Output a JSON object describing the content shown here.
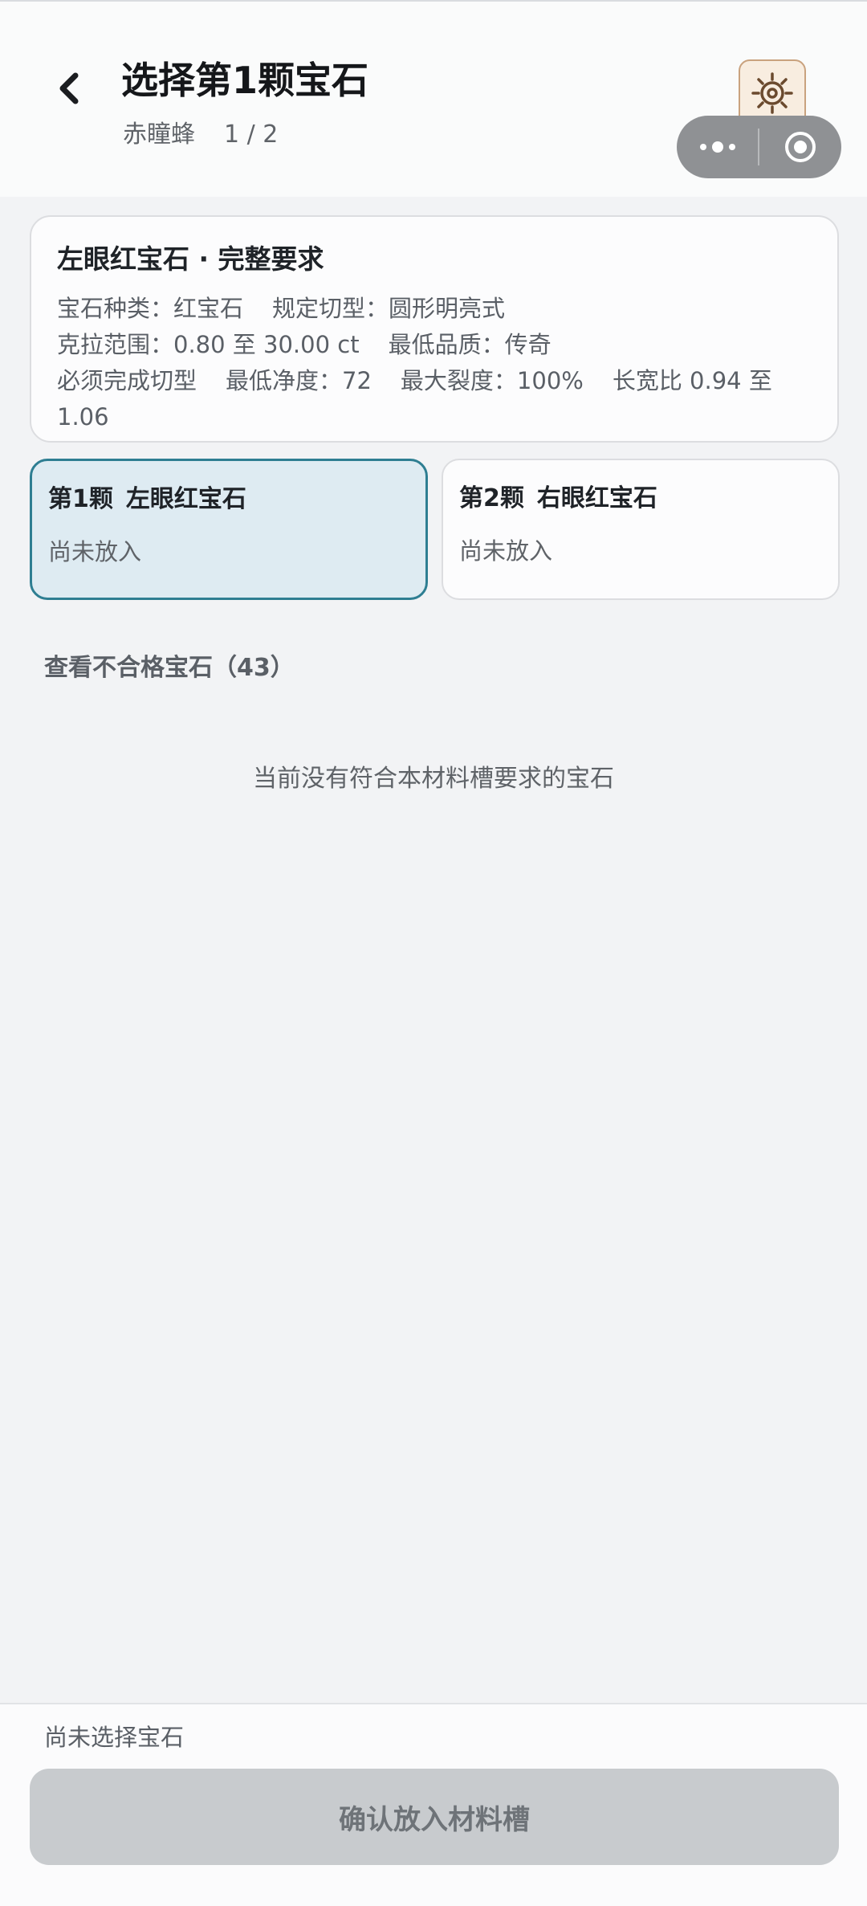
{
  "header": {
    "title": "选择第1颗宝石",
    "subtitle_name": "赤瞳蜂",
    "subtitle_progress": "1 / 2"
  },
  "requirements": {
    "title": "左眼红宝石 · 完整要求",
    "gem_type": "宝石种类：红宝石",
    "cut": "规定切型：圆形明亮式",
    "carat": "克拉范围：0.80 至 30.00 ct",
    "grade": "最低品质：传奇",
    "must_cut": "必须完成切型",
    "clarity": "最低净度：72",
    "cracks": "最大裂度：100%",
    "ratio": "长宽比 0.94 至",
    "ratio_cont": "1.06"
  },
  "slots": [
    {
      "index": "第1颗",
      "name": "左眼红宝石",
      "status": "尚未放入",
      "selected": true
    },
    {
      "index": "第2颗",
      "name": "右眼红宝石",
      "status": "尚未放入",
      "selected": false
    }
  ],
  "ineligible_link": "查看不合格宝石（43）",
  "empty_message": "当前没有符合本材料槽要求的宝石",
  "footer": {
    "status": "尚未选择宝石",
    "confirm_label": "确认放入材料槽"
  },
  "icons": {
    "back": "chevron-left-icon",
    "gear": "gear-icon",
    "more": "more-dots-icon",
    "record": "record-circle-icon"
  },
  "colors": {
    "accent": "#2e7e92",
    "selected_bg": "#deebf2",
    "disabled_button": "#c8cbce"
  }
}
